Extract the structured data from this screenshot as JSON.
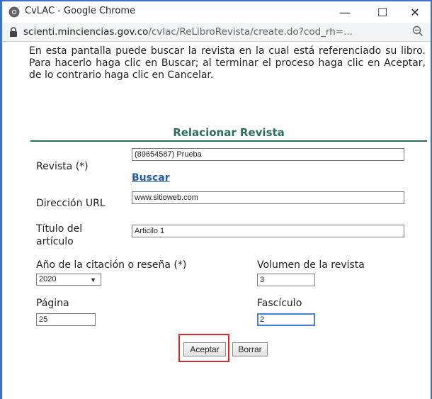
{
  "window": {
    "title": "CvLAC - Google Chrome",
    "minimize_glyph": "—",
    "maximize_glyph": "☐",
    "close_glyph": "✕"
  },
  "address_bar": {
    "host": "scienti.minciencias.gov.co",
    "path": "/cvlac/ReLibroRevista/create.do?cod_rh=..."
  },
  "intro_text": "En esta pantalla puede buscar la revista en la cual está referenciado su libro. Para hacerlo haga clic en Buscar; al terminar el proceso haga clic en Aceptar, de lo contrario haga clic en Cancelar.",
  "form": {
    "section_title": "Relacionar Revista",
    "revista_label": "Revista (*)",
    "revista_value": "(89654587) Prueba",
    "buscar_link": "Buscar",
    "url_label": "Dirección URL",
    "url_value": "www.sitioweb.com",
    "titulo_label_line1": "Título del",
    "titulo_label_line2": "artículo",
    "titulo_value": "Articilo 1",
    "anio_label": "Año de la citación o reseña (*)",
    "anio_value": "2020",
    "volumen_label": "Volumen de la revista",
    "volumen_value": "3",
    "pagina_label": "Página",
    "pagina_value": "25",
    "fasciculo_label": "Fascículo",
    "fasciculo_value": "2",
    "aceptar_label": "Aceptar",
    "borrar_label": "Borrar"
  },
  "colors": {
    "window_border": "#3d6fc7",
    "section_title": "#2f6d5f",
    "link": "#1f5bb5",
    "highlight": "#d9262a"
  }
}
